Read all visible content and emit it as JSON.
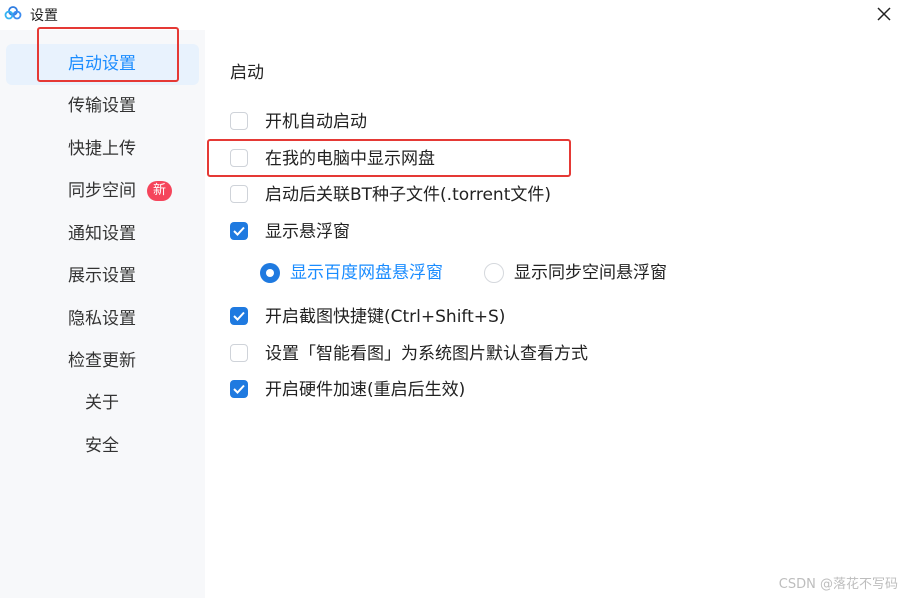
{
  "window": {
    "title": "设置",
    "close_icon": "close-icon",
    "logo_icon": "baidu-netdisk-logo-icon"
  },
  "sidebar": {
    "items": [
      {
        "label": "启动设置",
        "active": true
      },
      {
        "label": "传输设置"
      },
      {
        "label": "快捷上传"
      },
      {
        "label": "同步空间",
        "badge": "新"
      },
      {
        "label": "通知设置"
      },
      {
        "label": "展示设置"
      },
      {
        "label": "隐私设置"
      },
      {
        "label": "检查更新"
      },
      {
        "label": "关于"
      },
      {
        "label": "安全"
      }
    ]
  },
  "main": {
    "section_title": "启动",
    "options": [
      {
        "label": "开机自动启动",
        "checked": false
      },
      {
        "label": "在我的电脑中显示网盘",
        "checked": false
      },
      {
        "label": "启动后关联BT种子文件(.torrent文件)",
        "checked": false
      },
      {
        "label": "显示悬浮窗",
        "checked": true
      },
      {
        "label": "开启截图快捷键(Ctrl+Shift+S)",
        "checked": true
      },
      {
        "label": "设置「智能看图」为系统图片默认查看方式",
        "checked": false
      },
      {
        "label": "开启硬件加速(重启后生效)",
        "checked": true
      }
    ],
    "float_radio": [
      {
        "label": "显示百度网盘悬浮窗",
        "selected": true
      },
      {
        "label": "显示同步空间悬浮窗",
        "selected": false
      }
    ]
  },
  "watermark": "CSDN @落花不写码",
  "colors": {
    "accent": "#1f7ae0",
    "active_text": "#1a8cff",
    "sidebar_bg": "#f7f8fa",
    "badge": "#f5455b",
    "highlight": "#e53935"
  }
}
